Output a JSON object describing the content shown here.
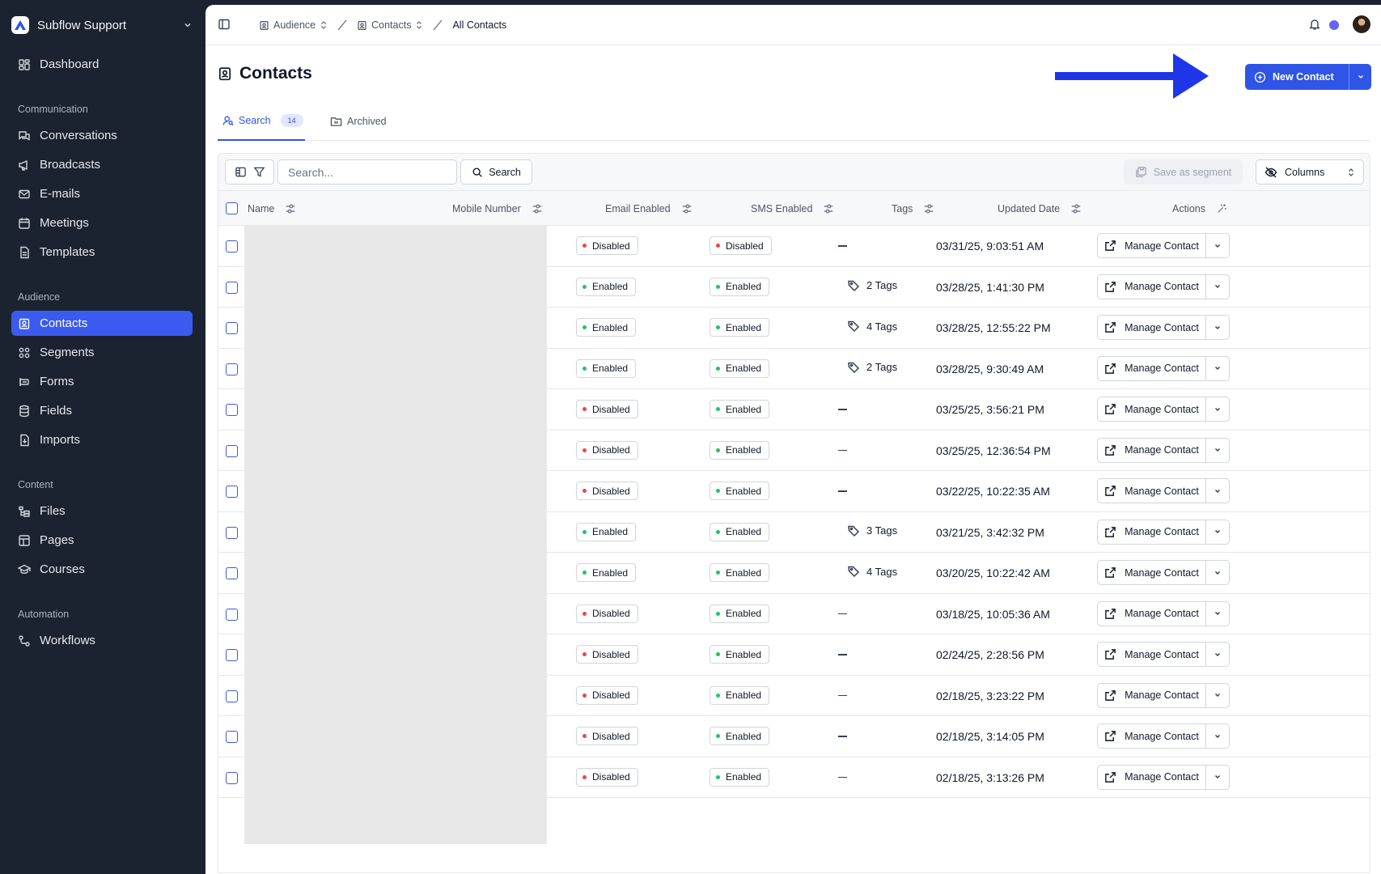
{
  "workspace": {
    "name": "Subflow Support"
  },
  "sidebar": {
    "top": {
      "label": "Dashboard",
      "icon": "dashboard-icon"
    },
    "sections": [
      {
        "title": "Communication",
        "items": [
          {
            "label": "Conversations",
            "icon": "conversations-icon"
          },
          {
            "label": "Broadcasts",
            "icon": "megaphone-icon"
          },
          {
            "label": "E-mails",
            "icon": "mail-icon"
          },
          {
            "label": "Meetings",
            "icon": "calendar-icon"
          },
          {
            "label": "Templates",
            "icon": "template-icon"
          }
        ]
      },
      {
        "title": "Audience",
        "items": [
          {
            "label": "Contacts",
            "icon": "contact-icon",
            "active": true
          },
          {
            "label": "Segments",
            "icon": "segments-icon"
          },
          {
            "label": "Forms",
            "icon": "form-icon"
          },
          {
            "label": "Fields",
            "icon": "database-icon"
          },
          {
            "label": "Imports",
            "icon": "import-icon"
          }
        ]
      },
      {
        "title": "Content",
        "items": [
          {
            "label": "Files",
            "icon": "files-icon"
          },
          {
            "label": "Pages",
            "icon": "pages-icon"
          },
          {
            "label": "Courses",
            "icon": "graduation-cap-icon"
          }
        ]
      },
      {
        "title": "Automation",
        "items": [
          {
            "label": "Workflows",
            "icon": "workflow-icon"
          }
        ]
      }
    ]
  },
  "breadcrumb": {
    "audience": "Audience",
    "contacts": "Contacts",
    "current": "All Contacts"
  },
  "page": {
    "title": "Contacts",
    "new_contact_label": "New Contact"
  },
  "tabs": {
    "search_label": "Search",
    "search_count": "14",
    "archived_label": "Archived"
  },
  "toolbar": {
    "search_placeholder": "Search...",
    "search_button": "Search",
    "save_segment": "Save as segment",
    "columns": "Columns"
  },
  "columns": {
    "name": "Name",
    "mobile": "Mobile Number",
    "email_enabled": "Email Enabled",
    "sms_enabled": "SMS Enabled",
    "tags": "Tags",
    "updated": "Updated Date",
    "actions": "Actions"
  },
  "manage_label": "Manage Contact",
  "status_colors": {
    "Enabled": "#22c55e",
    "Disabled": "#ef4444"
  },
  "rows": [
    {
      "email": "Disabled",
      "sms": "Disabled",
      "tags": "",
      "date": "03/31/25, 9:03:51 AM"
    },
    {
      "email": "Enabled",
      "sms": "Enabled",
      "tags": "2 Tags",
      "date": "03/28/25, 1:41:30 PM"
    },
    {
      "email": "Enabled",
      "sms": "Enabled",
      "tags": "4 Tags",
      "date": "03/28/25, 12:55:22 PM"
    },
    {
      "email": "Enabled",
      "sms": "Enabled",
      "tags": "2 Tags",
      "date": "03/28/25, 9:30:49 AM"
    },
    {
      "email": "Disabled",
      "sms": "Enabled",
      "tags": "",
      "date": "03/25/25, 3:56:21 PM"
    },
    {
      "email": "Disabled",
      "sms": "Enabled",
      "tags": "",
      "date": "03/25/25, 12:36:54 PM"
    },
    {
      "email": "Disabled",
      "sms": "Enabled",
      "tags": "",
      "date": "03/22/25, 10:22:35 AM"
    },
    {
      "email": "Enabled",
      "sms": "Enabled",
      "tags": "3 Tags",
      "date": "03/21/25, 3:42:32 PM"
    },
    {
      "email": "Enabled",
      "sms": "Enabled",
      "tags": "4 Tags",
      "date": "03/20/25, 10:22:42 AM"
    },
    {
      "email": "Disabled",
      "sms": "Enabled",
      "tags": "",
      "date": "03/18/25, 10:05:36 AM"
    },
    {
      "email": "Disabled",
      "sms": "Enabled",
      "tags": "",
      "date": "02/24/25, 2:28:56 PM"
    },
    {
      "email": "Disabled",
      "sms": "Enabled",
      "tags": "",
      "date": "02/18/25, 3:23:22 PM"
    },
    {
      "email": "Disabled",
      "sms": "Enabled",
      "tags": "",
      "date": "02/18/25, 3:14:05 PM"
    },
    {
      "email": "Disabled",
      "sms": "Enabled",
      "tags": "",
      "date": "02/18/25, 3:13:26 PM"
    }
  ]
}
